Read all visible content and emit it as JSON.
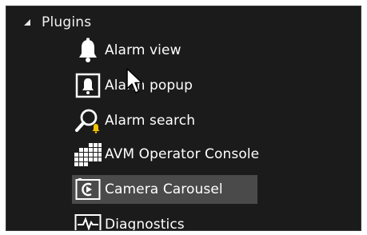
{
  "tree": {
    "group": {
      "label": "Plugins",
      "expanded": true,
      "expander_icon": "triangle-down-icon"
    },
    "items": [
      {
        "label": "Alarm view",
        "icon": "bell-icon",
        "selected": false
      },
      {
        "label": "Alarm popup",
        "icon": "framed-bell-icon",
        "selected": false
      },
      {
        "label": "Alarm search",
        "icon": "magnifier-bell-icon",
        "selected": false
      },
      {
        "label": "AVM Operator Console",
        "icon": "keypad-grid-icon",
        "selected": false
      },
      {
        "label": "Camera Carousel",
        "icon": "carousel-play-icon",
        "selected": true
      },
      {
        "label": "Diagnostics",
        "icon": "heartbeat-monitor-icon",
        "selected": false
      }
    ]
  },
  "colors": {
    "background": "#1b1b1b",
    "selected_row": "#4a4a4a",
    "text": "#ffffff",
    "alarm_accent": "#f2c200"
  }
}
